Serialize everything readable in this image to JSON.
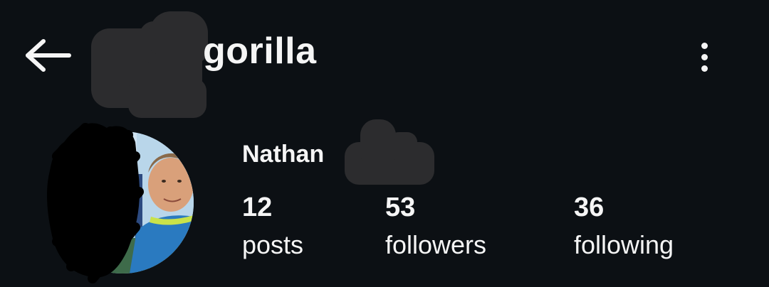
{
  "header": {
    "username_visible": "gorilla",
    "back_icon": "arrow-left-icon",
    "more_icon": "more-vertical-icon"
  },
  "profile": {
    "display_name_visible": "Nathan",
    "avatar": "avatar"
  },
  "stats": [
    {
      "count": "12",
      "label": "posts"
    },
    {
      "count": "53",
      "label": "followers"
    },
    {
      "count": "36",
      "label": "following"
    }
  ],
  "colors": {
    "background": "#0c1014",
    "text": "#f5f5f5",
    "redaction": "#2c2c2e"
  }
}
